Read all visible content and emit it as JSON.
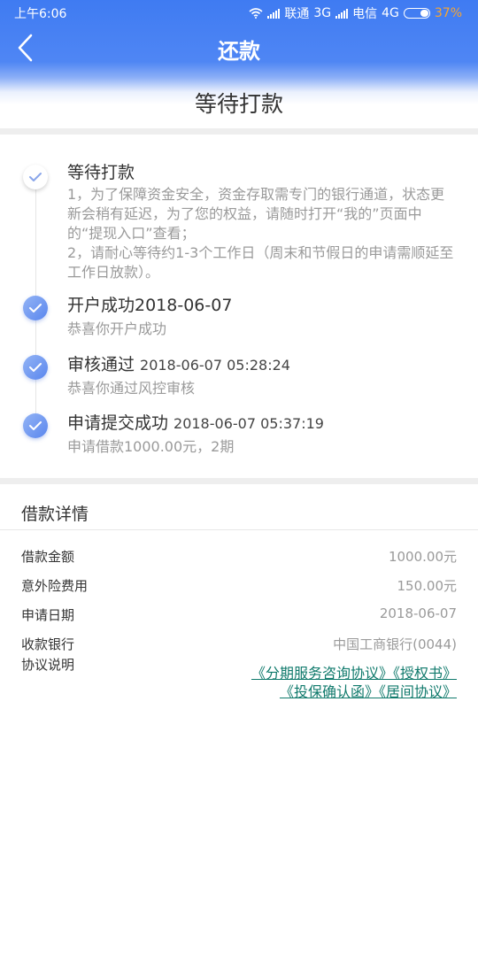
{
  "status_bar": {
    "time": "上午6:06",
    "carrier1": "联通",
    "net1": "3G",
    "carrier2": "电信",
    "net2": "4G",
    "battery": "37%",
    "battery_color": "#f7a531"
  },
  "nav": {
    "title": "还款",
    "back_icon": "chevron-left-icon",
    "color": "#3f7bf2"
  },
  "page": {
    "subtitle": "等待打款"
  },
  "timeline": [
    {
      "title": "等待打款",
      "time": "",
      "desc": "1，为了保障资金安全，资金存取需专门的银行通道，状态更新会稍有延迟，为了您的权益，请随时打开“我的”页面中的“提现入口”查看；\n2，请耐心等待约1-3个工作日（周末和节假日的申请需顺延至工作日放款）。",
      "state": "active"
    },
    {
      "title": "开户成功2018-06-07",
      "time": "",
      "desc": "恭喜你开户成功",
      "state": "done"
    },
    {
      "title": "审核通过",
      "time": "2018-06-07 05:28:24",
      "desc": "恭喜你通过风控审核",
      "state": "done"
    },
    {
      "title": "申请提交成功",
      "time": "2018-06-07 05:37:19",
      "desc": "申请借款1000.00元，2期",
      "state": "done"
    }
  ],
  "details": {
    "title": "借款详情",
    "rows": [
      {
        "label": "借款金额",
        "value": "1000.00元"
      },
      {
        "label": "意外险费用",
        "value": "150.00元"
      },
      {
        "label": "申请日期",
        "value": "2018-06-07"
      },
      {
        "label": "收款银行",
        "value": "中国工商银行(0044)"
      }
    ],
    "agreement_label": "协议说明",
    "agreements": [
      "《分期服务咨询协议》",
      "《授权书》",
      "《投保确认函》",
      "《居间协议》"
    ],
    "link_color": "#107a6c"
  }
}
